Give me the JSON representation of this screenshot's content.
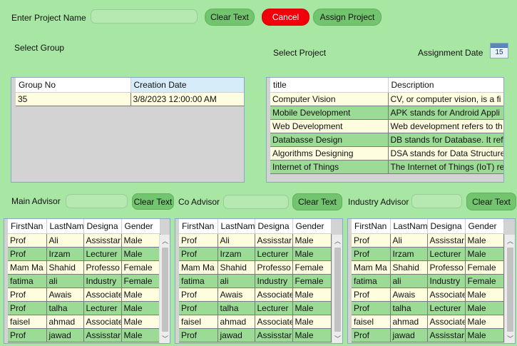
{
  "project_name": {
    "label": "Enter Project Name",
    "value": ""
  },
  "buttons": {
    "clear_text": "Clear Text",
    "cancel": "Cancel",
    "assign_project": "Assign Project"
  },
  "select_group_label": "Select Group",
  "select_project_label": "Select Project",
  "assignment_date_label": "Assignment Date",
  "calendar_day": "15",
  "group_table": {
    "headers": [
      "Group No",
      "Creation Date"
    ],
    "rows": [
      [
        "35",
        "3/8/2023 12:00:00 AM"
      ]
    ]
  },
  "project_table": {
    "headers": [
      "title",
      "Description"
    ],
    "rows": [
      [
        "Computer Vision",
        "CV, or computer vision, is a fi"
      ],
      [
        "Mobile Development",
        "APK stands for Android Appli"
      ],
      [
        "Web Development",
        "Web development refers to th"
      ],
      [
        "Databasse Design",
        "DB stands for Database. It refe"
      ],
      [
        "Algorithms Designing",
        "DSA stands for Data Structure"
      ],
      [
        "Internet of Things",
        "The Internet of Things (IoT) re"
      ]
    ]
  },
  "advisors": {
    "main_label": "Main Advisor",
    "co_label": "Co Advisor",
    "industry_label": "Industry Advisor",
    "main_value": "",
    "co_value": "",
    "industry_value": ""
  },
  "advisor_table": {
    "headers": [
      "FirstNan",
      "LastNam",
      "Designa",
      "Gender"
    ],
    "rows": [
      [
        "Prof",
        "Ali",
        "Assisstar",
        "Male"
      ],
      [
        "Prof",
        "Irzam",
        "Lecturer",
        "Male"
      ],
      [
        "Mam Ma",
        "Shahid",
        "Professo",
        "Female"
      ],
      [
        "fatima",
        "ali",
        "Industry",
        "Female"
      ],
      [
        "Prof",
        "Awais",
        "Associate",
        "Male"
      ],
      [
        "Prof",
        "talha",
        "Lecturer",
        "Male"
      ],
      [
        "faisel",
        "ahmad",
        "Associate",
        "Male"
      ],
      [
        "Prof",
        "jawad",
        "Assisstar",
        "Male"
      ]
    ]
  }
}
